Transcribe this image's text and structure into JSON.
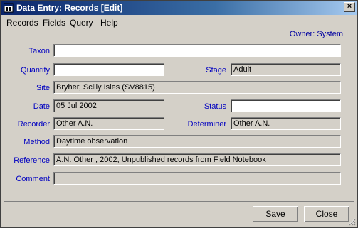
{
  "window": {
    "title": "Data Entry: Records [Edit]",
    "close_label": "×"
  },
  "menu": {
    "items": [
      "Records",
      "Fields",
      "Query",
      "Help"
    ]
  },
  "owner": "Owner: System",
  "fields": {
    "taxon": {
      "label": "Taxon",
      "value": ""
    },
    "quantity": {
      "label": "Quantity",
      "value": ""
    },
    "stage": {
      "label": "Stage",
      "value": "Adult"
    },
    "site": {
      "label": "Site",
      "value": "Bryher, Scilly Isles   (SV8815)"
    },
    "date": {
      "label": "Date",
      "value": "05 Jul 2002"
    },
    "status": {
      "label": "Status",
      "value": ""
    },
    "recorder": {
      "label": "Recorder",
      "value": "Other A.N."
    },
    "determiner": {
      "label": "Determiner",
      "value": "Other A.N."
    },
    "method": {
      "label": "Method",
      "value": "Daytime observation"
    },
    "reference": {
      "label": "Reference",
      "value": "A.N. Other , 2002, Unpublished records from Field Notebook"
    },
    "comment": {
      "label": "Comment",
      "value": ""
    }
  },
  "buttons": {
    "save": "Save",
    "close": "Close"
  },
  "colors": {
    "label_blue": "#0000c0",
    "title_bar": "#0a246a",
    "face": "#d4d0c8"
  }
}
